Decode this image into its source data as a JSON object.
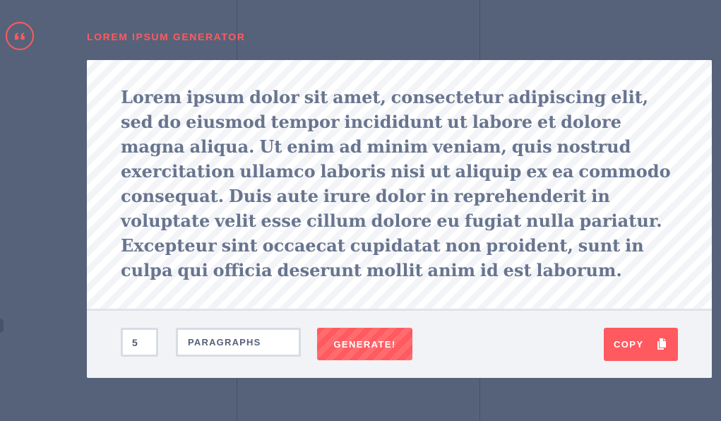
{
  "app": {
    "title": "LOREM IPSUM GENERATOR",
    "logo_icon": "quote-icon"
  },
  "output": {
    "text": "Lorem ipsum dolor sit amet, consectetur adipiscing elit, sed do eiusmod tempor incididunt ut labore et dolore magna aliqua. Ut enim ad minim veniam, quis nostrud exercitation ullamco laboris nisi ut aliquip ex ea commodo consequat. Duis aute irure dolor in reprehenderit in voluptate velit esse cillum dolore eu fugiat nulla pariatur. Excepteur sint occaecat cupidatat non proident, sunt in culpa qui officia deserunt mollit anim id est laborum."
  },
  "controls": {
    "count_value": "5",
    "unit_selected": "PARAGRAPHS",
    "generate_label": "GENERATE!",
    "copy_label": "COPY",
    "copy_icon": "copy-icon"
  },
  "colors": {
    "background": "#56627a",
    "accent": "#ff5a5f",
    "text": "#68758f",
    "panel": "#f2f3f6"
  }
}
